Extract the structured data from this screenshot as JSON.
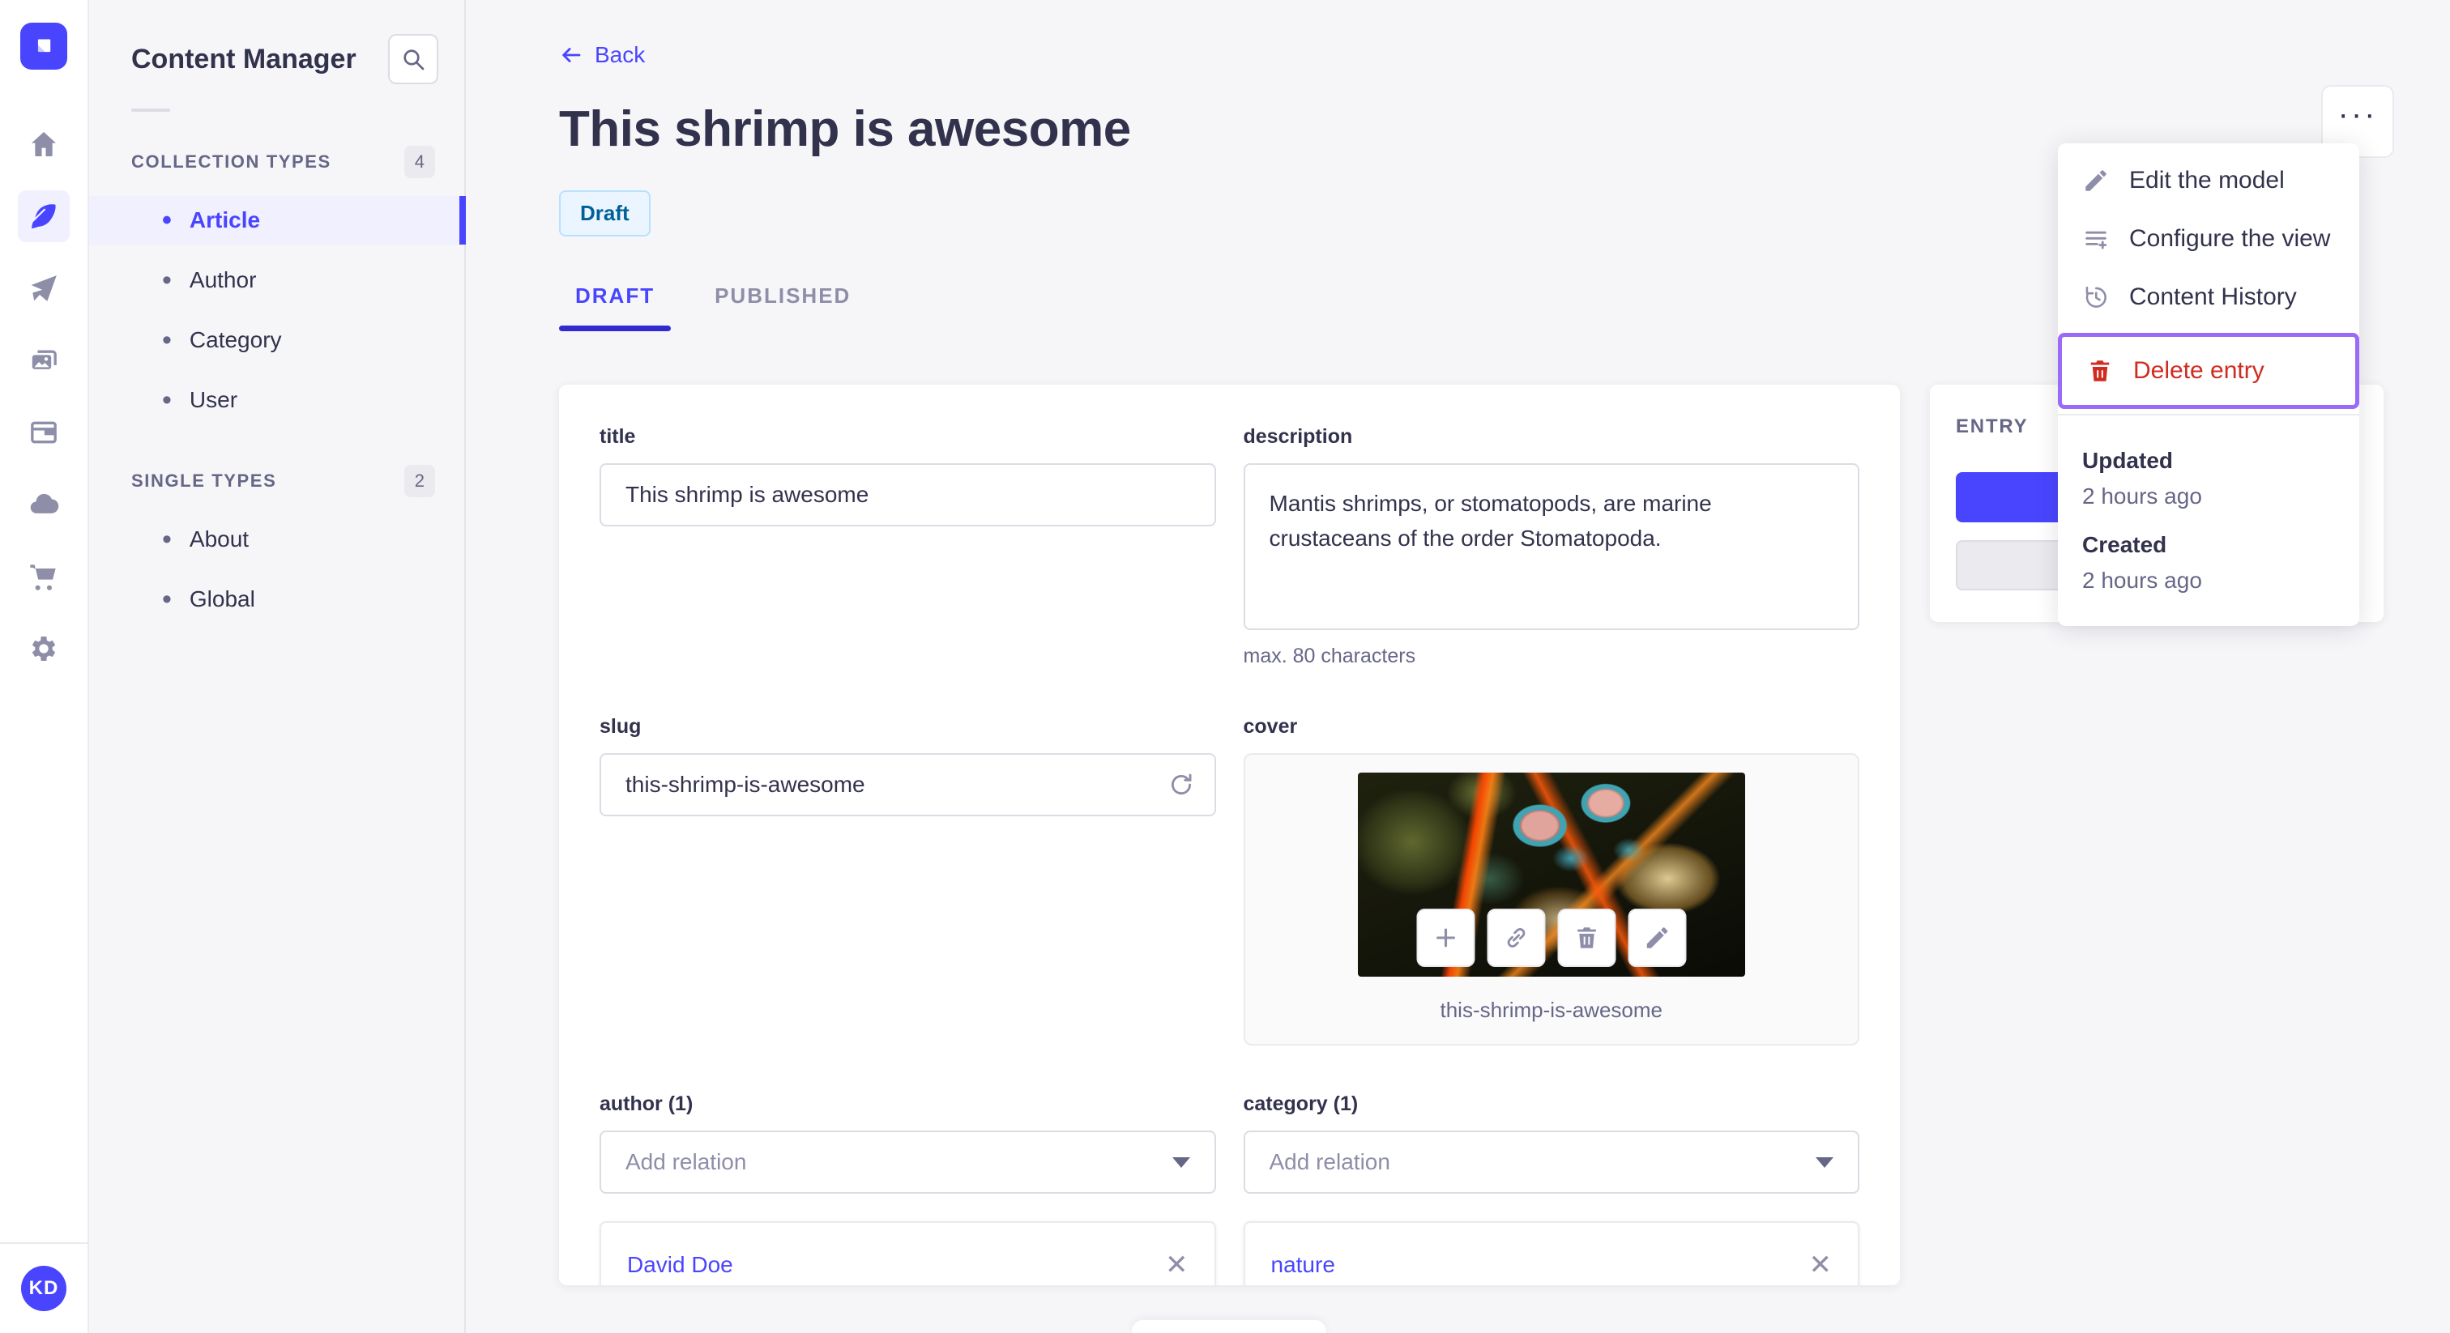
{
  "sidebar": {
    "logo_icon": "strapi-logo",
    "icons": [
      "home",
      "content-feather",
      "send-plane",
      "media-library",
      "layout",
      "cloud",
      "marketplace-cart",
      "settings-gear"
    ],
    "active_icon": "content-feather",
    "avatar": "KD"
  },
  "subnav": {
    "title": "Content Manager",
    "search_icon": "search",
    "sections": [
      {
        "label": "COLLECTION TYPES",
        "count": "4",
        "items": [
          {
            "label": "Article",
            "active": true
          },
          {
            "label": "Author"
          },
          {
            "label": "Category"
          },
          {
            "label": "User"
          }
        ]
      },
      {
        "label": "SINGLE TYPES",
        "count": "2",
        "items": [
          {
            "label": "About"
          },
          {
            "label": "Global"
          }
        ]
      }
    ]
  },
  "header": {
    "back": "Back",
    "title": "This shrimp is awesome",
    "status": "Draft",
    "tabs": [
      {
        "label": "DRAFT",
        "active": true
      },
      {
        "label": "PUBLISHED"
      }
    ],
    "more": "···"
  },
  "form": {
    "title": {
      "label": "title",
      "value": "This shrimp is awesome"
    },
    "description": {
      "label": "description",
      "value": "Mantis shrimps, or stomatopods, are marine crustaceans of the order Stomatopoda.",
      "hint": "max. 80 characters"
    },
    "slug": {
      "label": "slug",
      "value": "this-shrimp-is-awesome",
      "regenerate_icon": "refresh"
    },
    "cover": {
      "label": "cover",
      "caption": "this-shrimp-is-awesome",
      "action_icons": [
        "plus",
        "link",
        "trash",
        "pencil"
      ]
    },
    "author": {
      "label": "author (1)",
      "placeholder": "Add relation",
      "relation": "David Doe",
      "remove_icon": "✕"
    },
    "category": {
      "label": "category (1)",
      "placeholder": "Add relation",
      "relation": "nature",
      "remove_icon": "✕"
    }
  },
  "entry_panel": {
    "title": "ENTRY"
  },
  "menu": {
    "items": [
      {
        "label": "Edit the model",
        "icon": "pencil"
      },
      {
        "label": "Configure the view",
        "icon": "list-plus"
      },
      {
        "label": "Content History",
        "icon": "history-clock"
      },
      {
        "label": "Delete entry",
        "icon": "trash",
        "danger": true,
        "highlighted": true
      }
    ],
    "meta": [
      {
        "label": "Updated",
        "value": "2 hours ago"
      },
      {
        "label": "Created",
        "value": "2 hours ago"
      }
    ]
  },
  "colors": {
    "accent": "#4945ff",
    "danger": "#d02b20",
    "highlight_outline": "#9a6af8",
    "draft_bg": "#eaf5ff",
    "draft_text": "#006096",
    "draft_border": "#b8e1ff"
  }
}
